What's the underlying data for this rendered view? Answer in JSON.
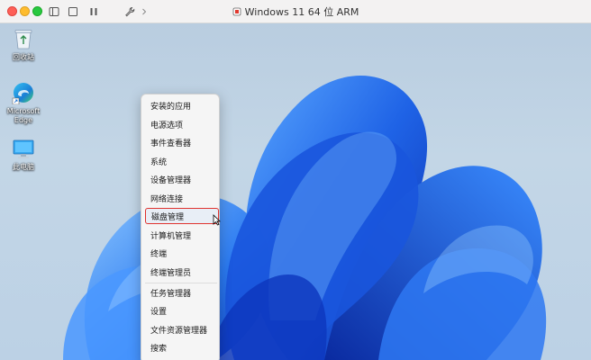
{
  "window": {
    "title": "Windows 11 64 位 ARM"
  },
  "toolbar_icons": [
    "sidebar-icon",
    "snapshot-icon",
    "wrench-icon",
    "chevron-right-icon"
  ],
  "desktop": {
    "icons": [
      {
        "id": "recycle-bin",
        "label": "回收站",
        "icon": "recycle-bin-icon"
      },
      {
        "id": "edge",
        "label": "Microsoft\nEdge",
        "icon": "edge-icon"
      },
      {
        "id": "this-pc",
        "label": "此电脑",
        "icon": "monitor-icon"
      }
    ]
  },
  "context_menu": {
    "items": [
      {
        "label": "安装的应用"
      },
      {
        "label": "电源选项"
      },
      {
        "label": "事件查看器"
      },
      {
        "label": "系统"
      },
      {
        "label": "设备管理器"
      },
      {
        "label": "网络连接"
      },
      {
        "label": "磁盘管理",
        "highlighted": true
      },
      {
        "label": "计算机管理"
      },
      {
        "label": "终端"
      },
      {
        "label": "终端管理员"
      },
      {
        "label": "任务管理器"
      },
      {
        "label": "设置"
      },
      {
        "label": "文件资源管理器"
      },
      {
        "label": "搜索"
      }
    ]
  },
  "colors": {
    "highlight_border": "#e0322e",
    "wallpaper_blue": "#1f63e6"
  }
}
